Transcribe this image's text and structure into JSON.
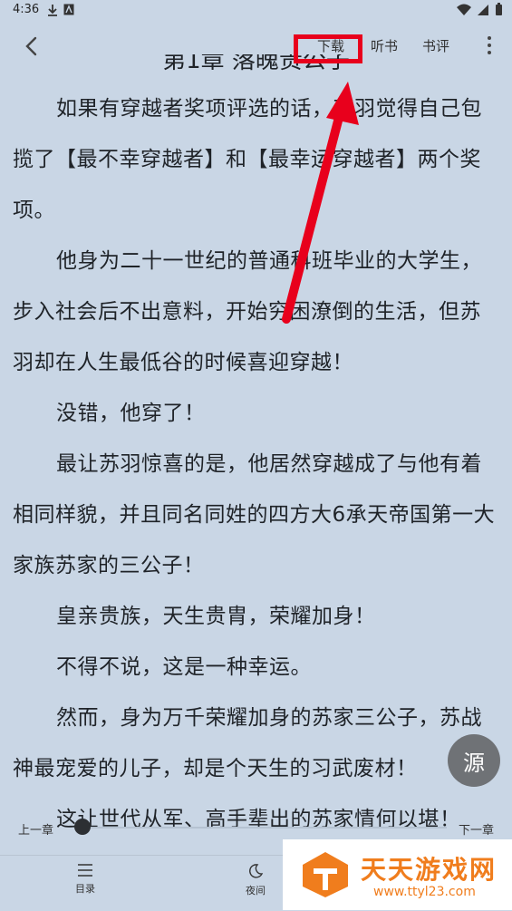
{
  "status_bar": {
    "time": "4:36"
  },
  "toolbar": {
    "download": "下载",
    "listen": "听书",
    "review": "书评"
  },
  "chapter": {
    "title": "第1章 落魄贵公子"
  },
  "content": {
    "paragraphs": [
      "如果有穿越者奖项评选的话，苏羽觉得自己包揽了【最不幸穿越者】和【最幸运穿越者】两个奖项。",
      "他身为二十一世纪的普通科班毕业的大学生，步入社会后不出意料，开始穷困潦倒的生活，但苏羽却在人生最低谷的时候喜迎穿越！",
      "没错，他穿了！",
      "最让苏羽惊喜的是，他居然穿越成了与他有着相同样貌，并且同名同姓的四方大6承天帝国第一大家族苏家的三公子！",
      "皇亲贵族，天生贵胄，荣耀加身！",
      "不得不说，这是一种幸运。",
      "然而，身为万千荣耀加身的苏家三公子，苏战神最宠爱的儿子，却是个天生的习武废材！",
      "这让世代从军、高手辈出的苏家情何以堪！"
    ]
  },
  "source_button": {
    "label": "源"
  },
  "slider": {
    "prev_label": "上一章",
    "next_label": "下一章",
    "progress": 0
  },
  "bottom_nav": {
    "catalog": "目录",
    "night": "夜间"
  },
  "watermark": {
    "title": "天天游戏网",
    "url": "www.ttyl23.com"
  },
  "colors": {
    "background": "#c9d6e5",
    "highlight": "#e8001c",
    "watermark": "#f07d1d"
  }
}
